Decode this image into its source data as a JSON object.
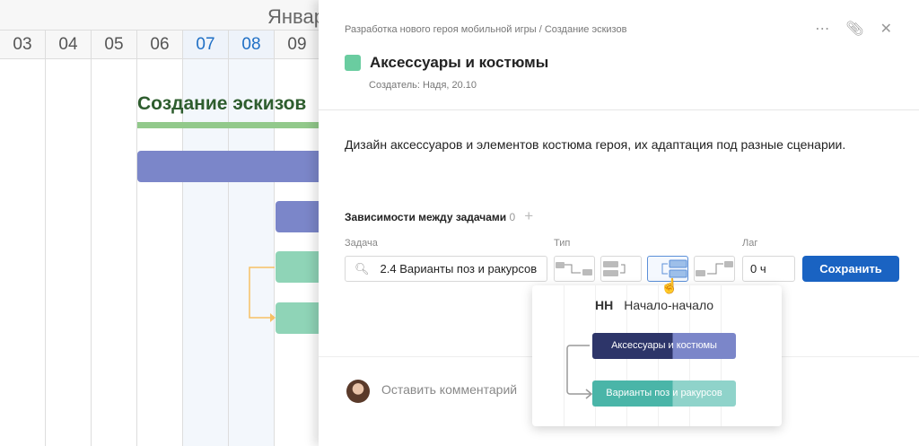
{
  "gantt": {
    "month": "Январь",
    "days": [
      "03",
      "04",
      "05",
      "06",
      "07",
      "08",
      "09"
    ],
    "highlighted_days": [
      "07",
      "08"
    ],
    "group_title": "Создание эскизов"
  },
  "panel": {
    "breadcrumb": "Разработка нового героя мобильной игры / Создание эскизов",
    "task_title": "Аксессуары и костюмы",
    "task_color": "#6acca0",
    "creator": "Создатель: Надя, 20.10",
    "description": "Дизайн аксессуаров и элементов костюма героя, их адаптация под разные сценарии.",
    "dependencies": {
      "title": "Зависимости между задачами",
      "count": "0",
      "add": "+",
      "task_label": "Задача",
      "task_value": "2.4 Варианты поз и ракурсов",
      "type_label": "Тип",
      "types": [
        "finish-to-start",
        "finish-to-finish",
        "start-to-start",
        "start-to-finish"
      ],
      "selected_type": "start-to-start",
      "lag_label": "Лаг",
      "lag_value": "0 ч",
      "save": "Сохранить"
    },
    "comment_placeholder": "Оставить комментарий"
  },
  "tooltip": {
    "code": "НН",
    "name": "Начало-начало",
    "bar1": "Аксессуары и костюмы",
    "bar2": "Варианты поз и ракурсов"
  }
}
